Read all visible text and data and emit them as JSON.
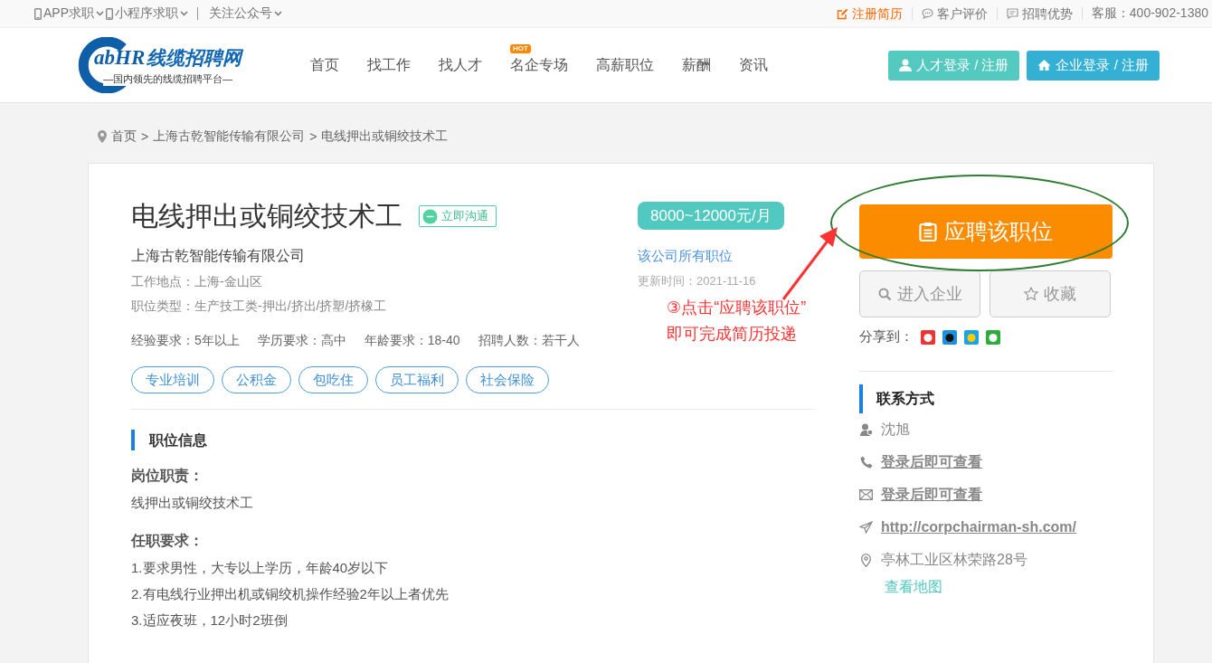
{
  "top_bar": {
    "left": [
      {
        "label": "APP求职"
      },
      {
        "label": "小程序求职"
      },
      {
        "label": "关注公众号"
      }
    ],
    "right": [
      {
        "label": "注册简历",
        "kind": "highlight"
      },
      {
        "label": "客户评价",
        "kind": "chat"
      },
      {
        "label": "招聘优势",
        "kind": "message"
      }
    ],
    "hotline": "客服：400-902-1380"
  },
  "header": {
    "logo": {
      "brand": "abHR",
      "name": "线缆招聘网",
      "slogan": "—国内领先的线缆招聘平台—"
    },
    "nav": [
      {
        "label": "首页"
      },
      {
        "label": "找工作"
      },
      {
        "label": "找人才"
      },
      {
        "label": "名企专场",
        "badge": "HOT"
      },
      {
        "label": "高薪职位"
      },
      {
        "label": "薪酬"
      },
      {
        "label": "资讯"
      }
    ],
    "buttons": [
      {
        "label": "人才登录 / 注册",
        "kind": "talent"
      },
      {
        "label": "企业登录 / 注册",
        "kind": "company"
      }
    ]
  },
  "breadcrumb": {
    "items": [
      "首页",
      "上海古乾智能传输有限公司",
      "电线押出或铜绞技术工"
    ],
    "separator": ">"
  },
  "job": {
    "title": "电线押出或铜绞技术工",
    "chat_button": "立即沟通",
    "company": "上海古乾智能传输有限公司",
    "location": "工作地点：上海-金山区",
    "category": "职位类型：生产技工类-押出/挤出/挤塑/挤橡工",
    "requirements": [
      "经验要求：5年以上",
      "学历要求：高中",
      "年龄要求：18-40",
      "招聘人数：若干人"
    ],
    "tags": [
      "专业培训",
      "公积金",
      "包吃住",
      "员工福利",
      "社会保险"
    ],
    "salary": "8000~12000元/月",
    "all_jobs_link": "该公司所有职位",
    "updated": "更新时间：2021-11-16",
    "section_title": "职位信息",
    "duties_heading": "岗位职责：",
    "duties": [
      "线押出或铜绞技术工"
    ],
    "requirements_heading": "任职要求：",
    "requirement_lines": [
      "1.要求男性，大专以上学历，年龄40岁以下",
      "2.有电线行业押出机或铜绞机操作经验2年以上者优先",
      "3.适应夜班，12小时2班倒"
    ]
  },
  "actions": {
    "apply_button": "应聘该职位",
    "buttons": [
      {
        "label": "进入企业",
        "kind": "search"
      },
      {
        "label": "收藏",
        "kind": "star"
      }
    ],
    "share_label": "分享到：",
    "share_targets": [
      {
        "kind": "weibo"
      },
      {
        "kind": "qq"
      },
      {
        "kind": "qzone"
      },
      {
        "kind": "wechat"
      }
    ]
  },
  "contact": {
    "title": "联系方式",
    "items": [
      {
        "kind": "person",
        "text": "沈旭",
        "link": false
      },
      {
        "kind": "phone",
        "text": "登录后即可查看",
        "link": true
      },
      {
        "kind": "email",
        "text": "登录后即可查看",
        "link": true
      },
      {
        "kind": "web",
        "text": "http://corpchairman-sh.com/",
        "link": true
      },
      {
        "kind": "address",
        "text": "亭林工业区林荣路28号",
        "link": false
      }
    ],
    "map_link": "查看地图"
  },
  "annotation": {
    "lines": [
      "③点击“应聘该职位”",
      "即可完成简历投递"
    ]
  }
}
